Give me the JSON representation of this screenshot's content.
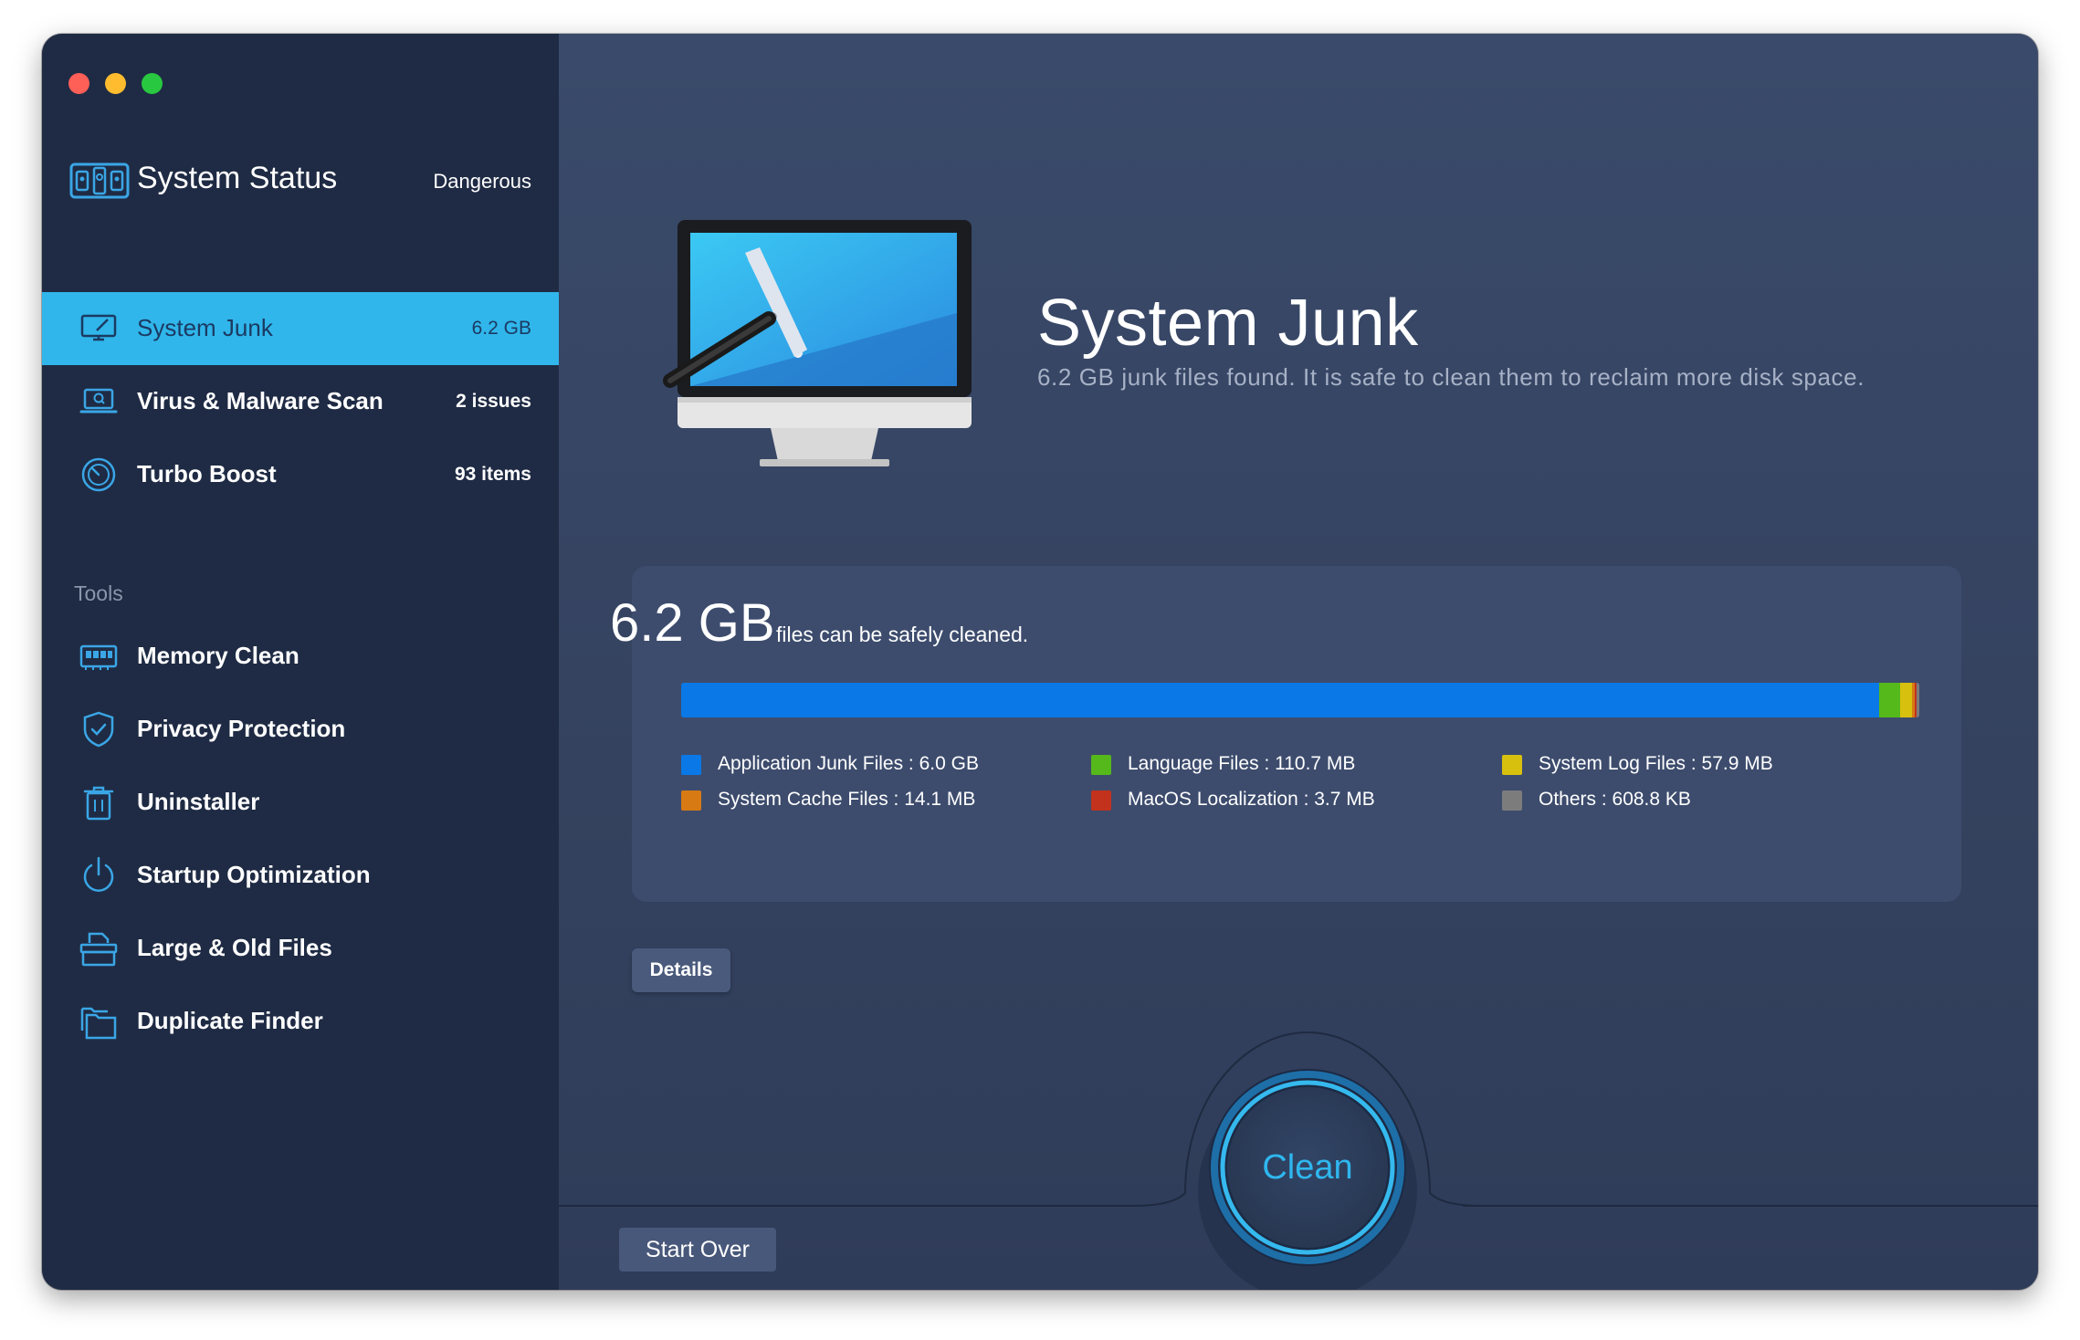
{
  "sidebar": {
    "status": {
      "title": "System Status",
      "value": "Dangerous",
      "icon": "system-status-icon"
    },
    "nav": [
      {
        "label": "System Junk",
        "badge": "6.2 GB",
        "icon": "monitor-broom-icon",
        "active": true
      },
      {
        "label": "Virus & Malware Scan",
        "badge": "2 issues",
        "icon": "laptop-scan-icon",
        "active": false
      },
      {
        "label": "Turbo Boost",
        "badge": "93 items",
        "icon": "gauge-icon",
        "active": false
      }
    ],
    "tools_heading": "Tools",
    "tools": [
      {
        "label": "Memory Clean",
        "icon": "memory-chip-icon"
      },
      {
        "label": "Privacy Protection",
        "icon": "shield-check-icon"
      },
      {
        "label": "Uninstaller",
        "icon": "trash-icon"
      },
      {
        "label": "Startup Optimization",
        "icon": "power-icon"
      },
      {
        "label": "Large & Old Files",
        "icon": "file-box-icon"
      },
      {
        "label": "Duplicate Finder",
        "icon": "duplicate-folder-icon"
      }
    ]
  },
  "main": {
    "title": "System Junk",
    "subtitle": "6.2 GB junk files found.  It is safe to clean them to reclaim more disk space.",
    "summary": {
      "size": "6.2 GB",
      "caption": "files can be safely cleaned."
    },
    "breakdown": [
      {
        "label": "Application Junk Files : 6.0 GB",
        "color": "#0a78e6",
        "fraction": 0.9674
      },
      {
        "label": "Language Files : 110.7 MB",
        "color": "#55b81b",
        "fraction": 0.0174
      },
      {
        "label": "System Log Files : 57.9 MB",
        "color": "#d8c00f",
        "fraction": 0.0091
      },
      {
        "label": "System Cache Files : 14.1 MB",
        "color": "#d77a14",
        "fraction": 0.0023
      },
      {
        "label": "MacOS Localization : 3.7 MB",
        "color": "#c2321c",
        "fraction": 0.0018
      },
      {
        "label": "Others : 608.8 KB",
        "color": "#7c7c7c",
        "fraction": 0.0018
      }
    ],
    "details_label": "Details",
    "start_over_label": "Start Over",
    "clean_label": "Clean"
  }
}
